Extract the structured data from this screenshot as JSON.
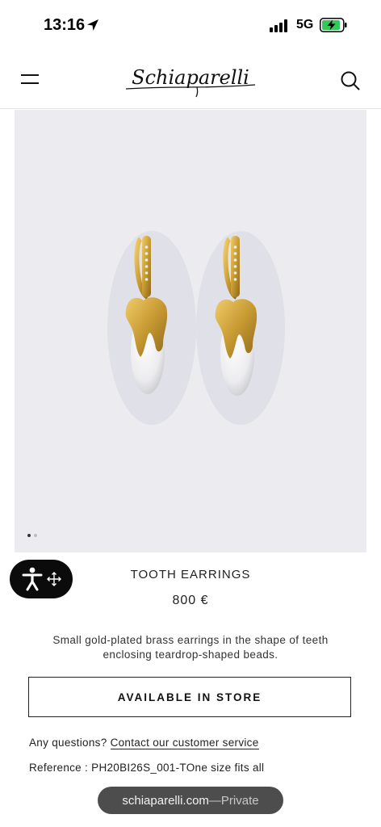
{
  "status_bar": {
    "time": "13:16",
    "network": "5G",
    "location_icon": "location-arrow-icon",
    "battery_charging": true,
    "battery_color": "#34c759"
  },
  "header": {
    "logo_text": "Schiaparelli",
    "menu_icon": "hamburger-menu-icon",
    "search_icon": "search-icon"
  },
  "product": {
    "title": "TOOTH EARRINGS",
    "price": "800 €",
    "description": "Small gold-plated brass earrings in the shape of teeth enclosing teardrop-shaped beads.",
    "cta_label": "AVAILABLE IN STORE",
    "questions_prefix": "Any questions?",
    "contact_link": "Contact our customer service",
    "reference": "Reference : PH20BI26S_001-TOne size fits all",
    "image_carousel": {
      "current": 1,
      "total": 2
    }
  },
  "accessibility_widget": {
    "icon": "accessibility-person-icon",
    "move_icon": "move-arrows-icon"
  },
  "browser": {
    "domain": "schiaparelli.com",
    "mode_separator": " — ",
    "mode": "Private"
  }
}
